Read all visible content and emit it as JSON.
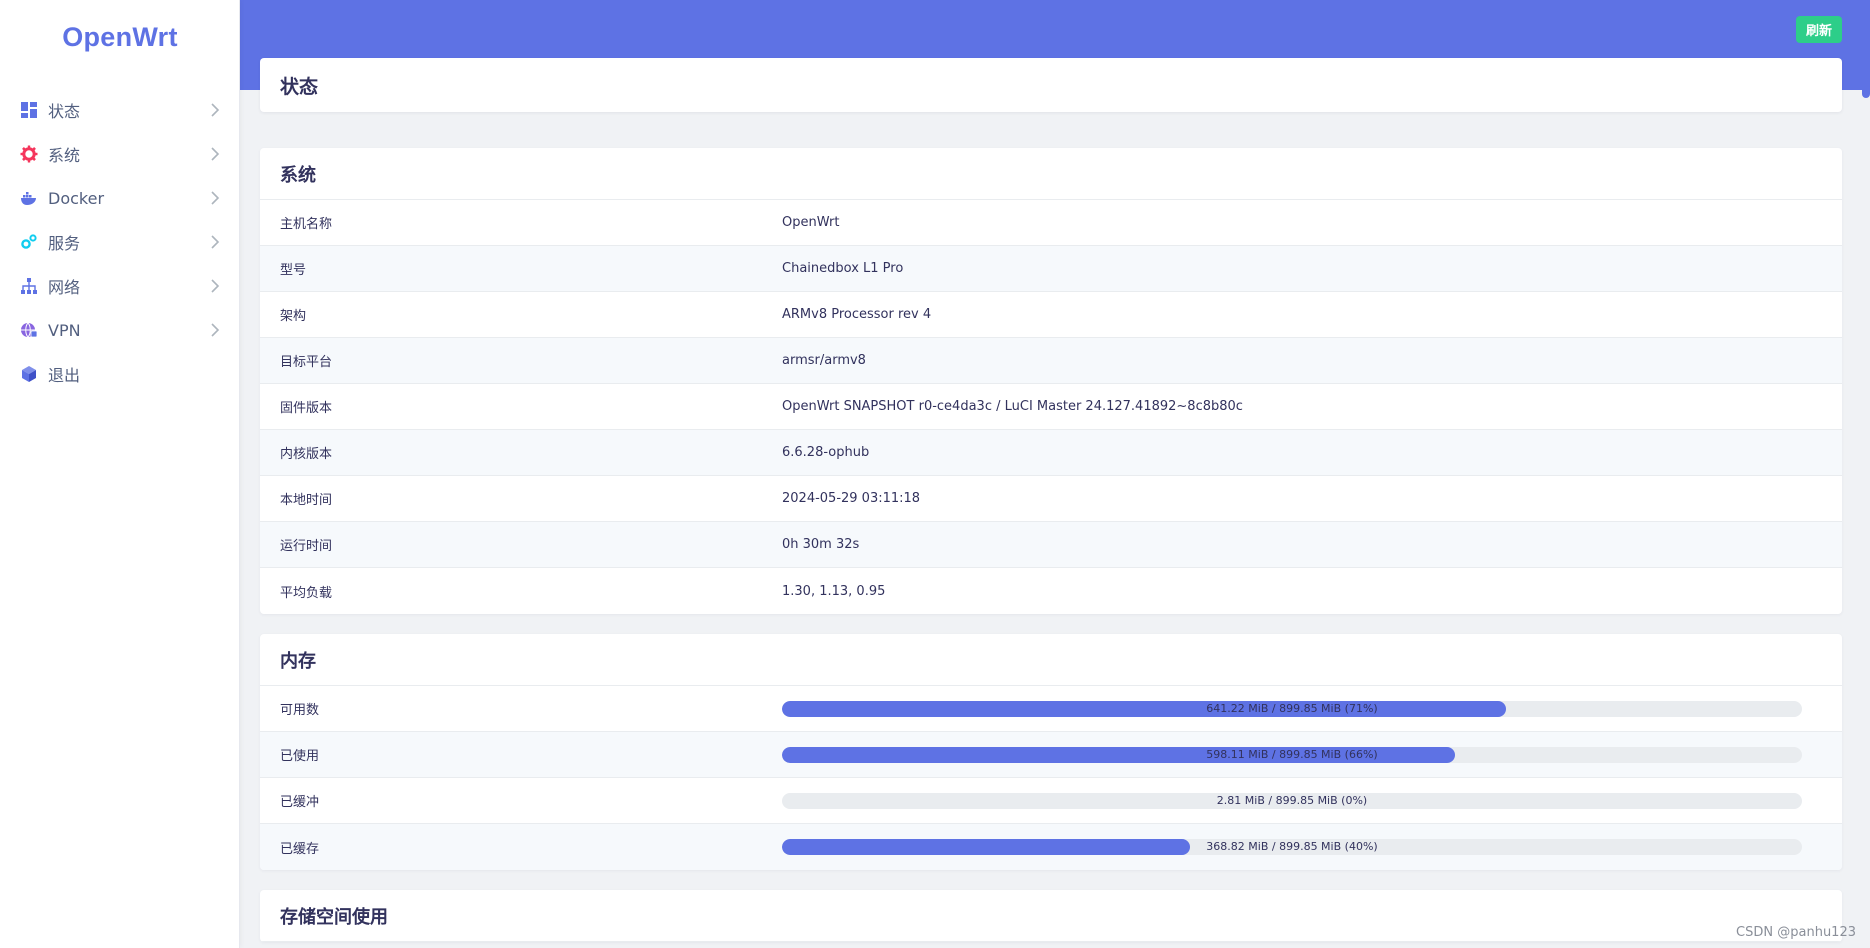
{
  "brand": "OpenWrt",
  "sidebar": {
    "items": [
      {
        "label": "状态",
        "icon": "dashboard-icon",
        "color": "#5e72e4",
        "has_submenu": true
      },
      {
        "label": "系统",
        "icon": "gear-icon",
        "color": "#f5365c",
        "has_submenu": true
      },
      {
        "label": "Docker",
        "icon": "docker-icon",
        "color": "#5e72e4",
        "has_submenu": true
      },
      {
        "label": "服务",
        "icon": "cogs-icon",
        "color": "#11cdef",
        "has_submenu": true
      },
      {
        "label": "网络",
        "icon": "sitemap-icon",
        "color": "#5e72e4",
        "has_submenu": true
      },
      {
        "label": "VPN",
        "icon": "globe-lock-icon",
        "color": "#8965e0",
        "has_submenu": true
      },
      {
        "label": "退出",
        "icon": "cube-icon",
        "color": "#5e72e4",
        "has_submenu": false
      }
    ]
  },
  "header": {
    "refresh_label": "刷新"
  },
  "page": {
    "title": "状态"
  },
  "system": {
    "title": "系统",
    "rows": [
      {
        "key": "主机名称",
        "value": "OpenWrt"
      },
      {
        "key": "型号",
        "value": "Chainedbox L1 Pro"
      },
      {
        "key": "架构",
        "value": "ARMv8 Processor rev 4"
      },
      {
        "key": "目标平台",
        "value": "armsr/armv8"
      },
      {
        "key": "固件版本",
        "value": "OpenWrt SNAPSHOT r0-ce4da3c / LuCI Master 24.127.41892~8c8b80c"
      },
      {
        "key": "内核版本",
        "value": "6.6.28-ophub"
      },
      {
        "key": "本地时间",
        "value": "2024-05-29 03:11:18"
      },
      {
        "key": "运行时间",
        "value": "0h 30m 32s"
      },
      {
        "key": "平均负载",
        "value": "1.30, 1.13, 0.95"
      }
    ]
  },
  "memory": {
    "title": "内存",
    "rows": [
      {
        "key": "可用数",
        "text": "641.22 MiB / 899.85 MiB (71%)",
        "fraction": 0.71
      },
      {
        "key": "已使用",
        "text": "598.11 MiB / 899.85 MiB (66%)",
        "fraction": 0.66
      },
      {
        "key": "已缓冲",
        "text": "2.81 MiB / 899.85 MiB (0%)",
        "fraction": 0.0
      },
      {
        "key": "已缓存",
        "text": "368.82 MiB / 899.85 MiB (40%)",
        "fraction": 0.4
      }
    ]
  },
  "storage": {
    "title": "存储空间使用"
  },
  "colors": {
    "accent": "#5e72e4",
    "success": "#2dce89",
    "background": "#f0f2f5"
  },
  "watermark": "CSDN @panhu123"
}
